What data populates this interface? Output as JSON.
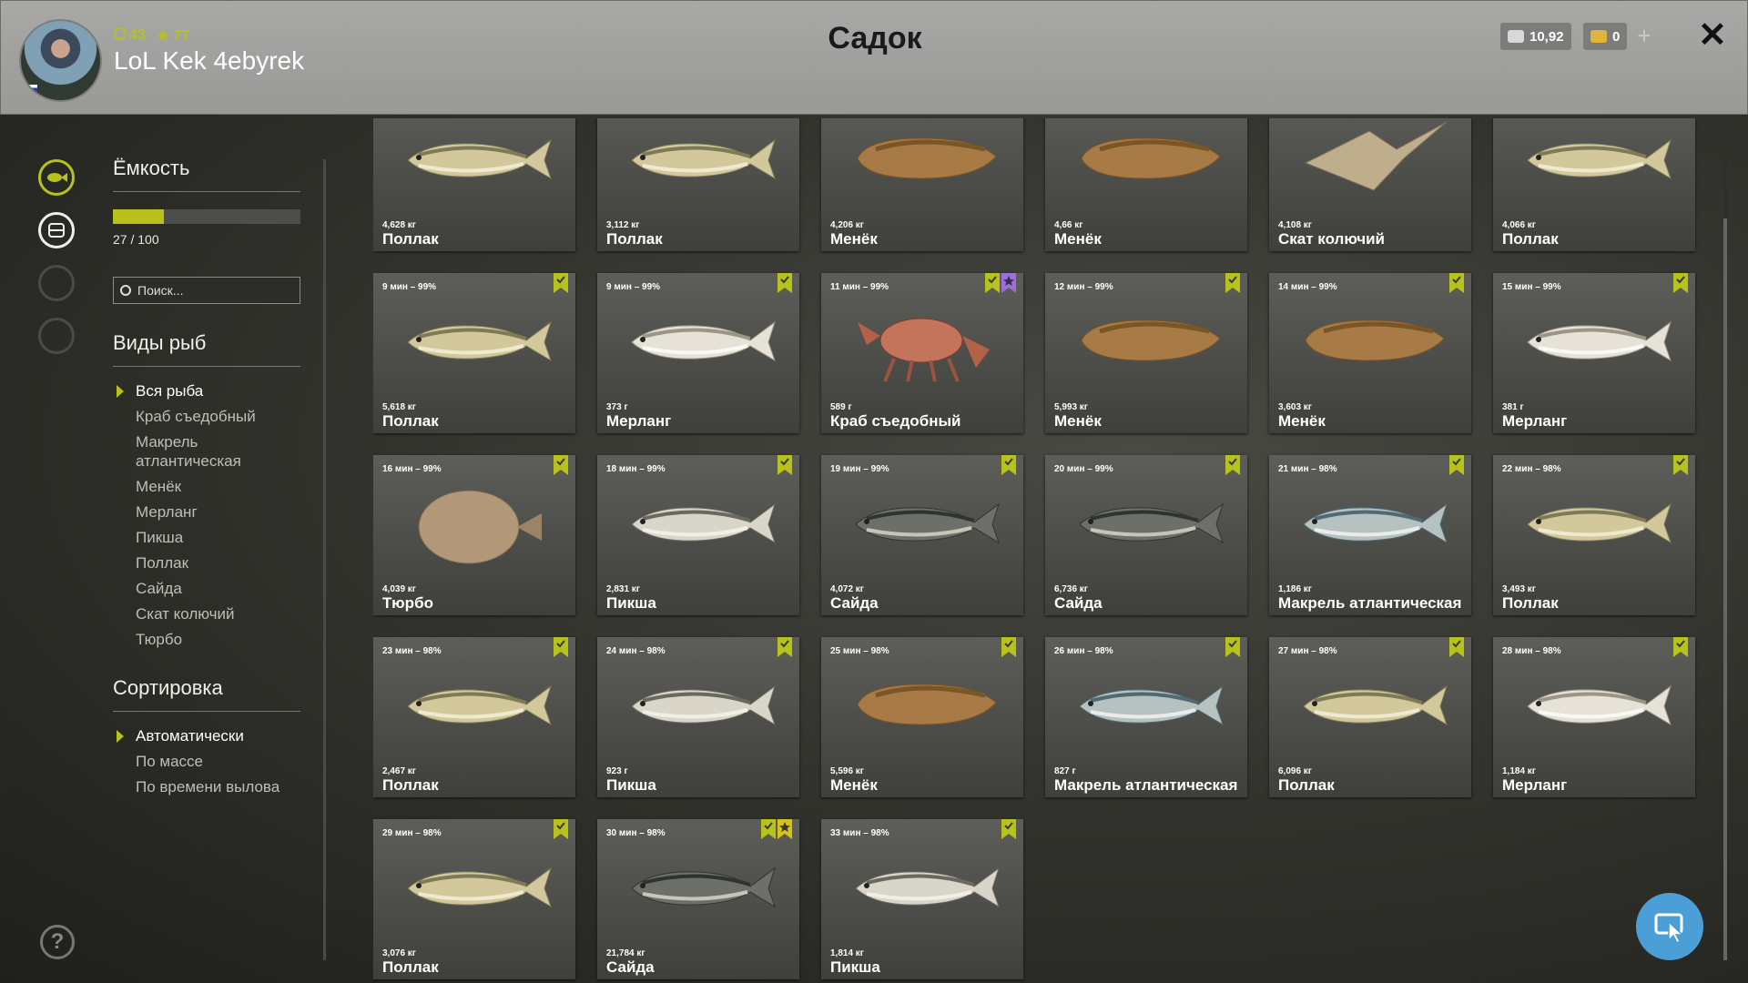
{
  "header": {
    "title": "Садок",
    "player_name": "LoL Kek 4ebyrek",
    "level": "43",
    "stars": "77",
    "silver": "10,92",
    "gold": "0",
    "close_icon": "close-icon",
    "add_icon": "plus-icon"
  },
  "sidebar": {
    "capacity_title": "Ёмкость",
    "capacity_value": 0.27,
    "capacity_label": "27 / 100",
    "search_placeholder": "Поиск...",
    "species_title": "Виды рыб",
    "species": [
      "Вся рыба",
      "Краб съедобный",
      "Макрель атлантическая",
      "Менёк",
      "Мерланг",
      "Пикша",
      "Поллак",
      "Сайда",
      "Скат колючий",
      "Тюрбо"
    ],
    "sort_title": "Сортировка",
    "sort": [
      "Автоматически",
      "По массе",
      "По времени вылова"
    ]
  },
  "colors": {
    "accent": "#b7c21c",
    "purple": "#9a70d8",
    "fab": "#4c9fd6"
  },
  "cards": [
    {
      "time": "",
      "weight": "4,628 кг",
      "name": "Поллак",
      "fish": "pollock",
      "marks": []
    },
    {
      "time": "",
      "weight": "3,112 кг",
      "name": "Поллак",
      "fish": "pollock",
      "marks": []
    },
    {
      "time": "",
      "weight": "4,206 кг",
      "name": "Менёк",
      "fish": "tusk",
      "marks": []
    },
    {
      "time": "",
      "weight": "4,66 кг",
      "name": "Менёк",
      "fish": "tusk",
      "marks": []
    },
    {
      "time": "",
      "weight": "4,108 кг",
      "name": "Скат колючий",
      "fish": "ray",
      "marks": []
    },
    {
      "time": "",
      "weight": "4,066 кг",
      "name": "Поллак",
      "fish": "pollock",
      "marks": []
    },
    {
      "time": "9 мин – 99%",
      "weight": "5,618 кг",
      "name": "Поллак",
      "fish": "pollock",
      "marks": [
        "check"
      ]
    },
    {
      "time": "9 мин – 99%",
      "weight": "373 г",
      "name": "Мерланг",
      "fish": "whiting",
      "marks": [
        "check"
      ]
    },
    {
      "time": "11 мин – 99%",
      "weight": "589 г",
      "name": "Краб съедобный",
      "fish": "crab",
      "marks": [
        "check",
        "star-purple"
      ]
    },
    {
      "time": "12 мин – 99%",
      "weight": "5,993 кг",
      "name": "Менёк",
      "fish": "tusk",
      "marks": [
        "check"
      ]
    },
    {
      "time": "14 мин – 99%",
      "weight": "3,603 кг",
      "name": "Менёк",
      "fish": "tusk",
      "marks": [
        "check"
      ]
    },
    {
      "time": "15 мин – 99%",
      "weight": "381 г",
      "name": "Мерланг",
      "fish": "whiting",
      "marks": [
        "check"
      ]
    },
    {
      "time": "16 мин – 99%",
      "weight": "4,039 кг",
      "name": "Тюрбо",
      "fish": "turbot",
      "marks": [
        "check"
      ]
    },
    {
      "time": "18 мин – 99%",
      "weight": "2,831 кг",
      "name": "Пикша",
      "fish": "haddock",
      "marks": [
        "check"
      ]
    },
    {
      "time": "19 мин – 99%",
      "weight": "4,072 кг",
      "name": "Сайда",
      "fish": "saithe",
      "marks": [
        "check"
      ]
    },
    {
      "time": "20 мин – 99%",
      "weight": "6,736 кг",
      "name": "Сайда",
      "fish": "saithe",
      "marks": [
        "check"
      ]
    },
    {
      "time": "21 мин – 98%",
      "weight": "1,186 кг",
      "name": "Макрель атлантическая",
      "fish": "mackerel",
      "marks": [
        "check"
      ]
    },
    {
      "time": "22 мин – 98%",
      "weight": "3,493 кг",
      "name": "Поллак",
      "fish": "pollock",
      "marks": [
        "check"
      ]
    },
    {
      "time": "23 мин – 98%",
      "weight": "2,467 кг",
      "name": "Поллак",
      "fish": "pollock",
      "marks": [
        "check"
      ]
    },
    {
      "time": "24 мин – 98%",
      "weight": "923 г",
      "name": "Пикша",
      "fish": "haddock",
      "marks": [
        "check"
      ]
    },
    {
      "time": "25 мин – 98%",
      "weight": "5,596 кг",
      "name": "Менёк",
      "fish": "tusk",
      "marks": [
        "check"
      ]
    },
    {
      "time": "26 мин – 98%",
      "weight": "827 г",
      "name": "Макрель атлантическая",
      "fish": "mackerel",
      "marks": [
        "check"
      ]
    },
    {
      "time": "27 мин – 98%",
      "weight": "6,096 кг",
      "name": "Поллак",
      "fish": "pollock",
      "marks": [
        "check"
      ]
    },
    {
      "time": "28 мин – 98%",
      "weight": "1,184 кг",
      "name": "Мерланг",
      "fish": "whiting",
      "marks": [
        "check"
      ]
    },
    {
      "time": "29 мин – 98%",
      "weight": "3,076 кг",
      "name": "Поллак",
      "fish": "pollock",
      "marks": [
        "check"
      ]
    },
    {
      "time": "30 мин – 98%",
      "weight": "21,784 кг",
      "name": "Сайда",
      "fish": "saithe",
      "marks": [
        "check",
        "star-yellow"
      ]
    },
    {
      "time": "33 мин – 98%",
      "weight": "1,814 кг",
      "name": "Пикша",
      "fish": "haddock",
      "marks": [
        "check"
      ]
    }
  ]
}
